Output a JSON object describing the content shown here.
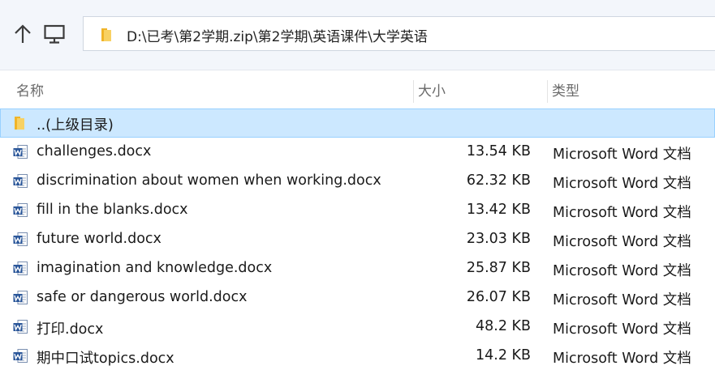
{
  "toolbar": {
    "up_icon": "up-arrow-icon",
    "computer_icon": "monitor-icon",
    "address_path": "D:\\已考\\第2学期.zip\\第2学期\\英语课件\\大学英语"
  },
  "columns": {
    "name": "名称",
    "size": "大小",
    "type": "类型"
  },
  "parent_row": {
    "name": "..(上级目录)",
    "icon": "folder-icon"
  },
  "files": [
    {
      "name": "challenges.docx",
      "size": "13.54 KB",
      "type": "Microsoft Word 文档"
    },
    {
      "name": "discrimination about women when working.docx",
      "size": "62.32 KB",
      "type": "Microsoft Word 文档"
    },
    {
      "name": "fill in the blanks.docx",
      "size": "13.42 KB",
      "type": "Microsoft Word 文档"
    },
    {
      "name": "future world.docx",
      "size": "23.03 KB",
      "type": "Microsoft Word 文档"
    },
    {
      "name": "imagination and knowledge.docx",
      "size": "25.87 KB",
      "type": "Microsoft Word 文档"
    },
    {
      "name": "safe or dangerous world.docx",
      "size": "26.07 KB",
      "type": "Microsoft Word 文档"
    },
    {
      "name": "打印.docx",
      "size": "48.2 KB",
      "type": "Microsoft Word 文档"
    },
    {
      "name": "期中口试topics.docx",
      "size": "14.2 KB",
      "type": "Microsoft Word 文档"
    }
  ],
  "colors": {
    "selection": "#cce8ff",
    "selection_border": "#99d1ff",
    "word_blue": "#2b579a",
    "folder_yellow": "#f6c342"
  }
}
